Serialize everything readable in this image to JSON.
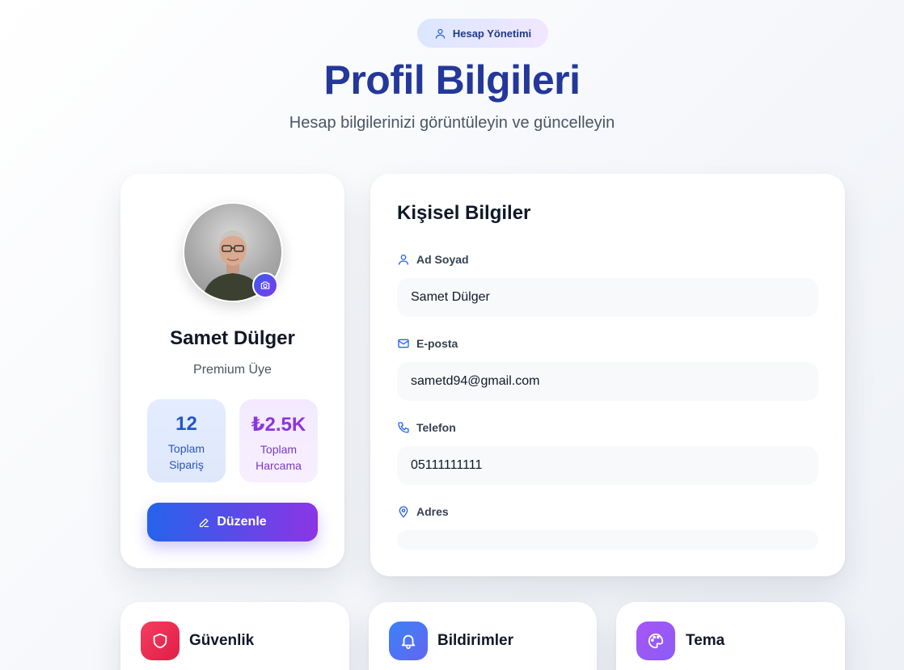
{
  "header": {
    "badge_label": "Hesap Yönetimi",
    "title": "Profil Bilgileri",
    "subtitle": "Hesap bilgilerinizi görüntüleyin ve güncelleyin"
  },
  "profile": {
    "name": "Samet Dülger",
    "role": "Premium Üye",
    "stats": [
      {
        "value": "12",
        "label": "Toplam Sipariş"
      },
      {
        "value": "₺2.5K",
        "label": "Toplam Harcama"
      }
    ],
    "edit_label": "Düzenle"
  },
  "personal_info": {
    "title": "Kişisel Bilgiler",
    "fields": [
      {
        "label": "Ad Soyad",
        "value": "Samet Dülger",
        "icon": "user-icon"
      },
      {
        "label": "E-posta",
        "value": "sametd94@gmail.com",
        "icon": "mail-icon"
      },
      {
        "label": "Telefon",
        "value": "05111111111",
        "icon": "phone-icon"
      },
      {
        "label": "Adres",
        "value": "",
        "icon": "map-pin-icon"
      }
    ]
  },
  "settings_cards": [
    {
      "title": "Güvenlik",
      "icon": "shield-icon"
    },
    {
      "title": "Bildirimler",
      "icon": "bell-icon"
    },
    {
      "title": "Tema",
      "icon": "palette-icon"
    }
  ],
  "colors": {
    "title": "#23389a",
    "gradient_start": "#2563eb",
    "gradient_end": "#8b35e6"
  }
}
